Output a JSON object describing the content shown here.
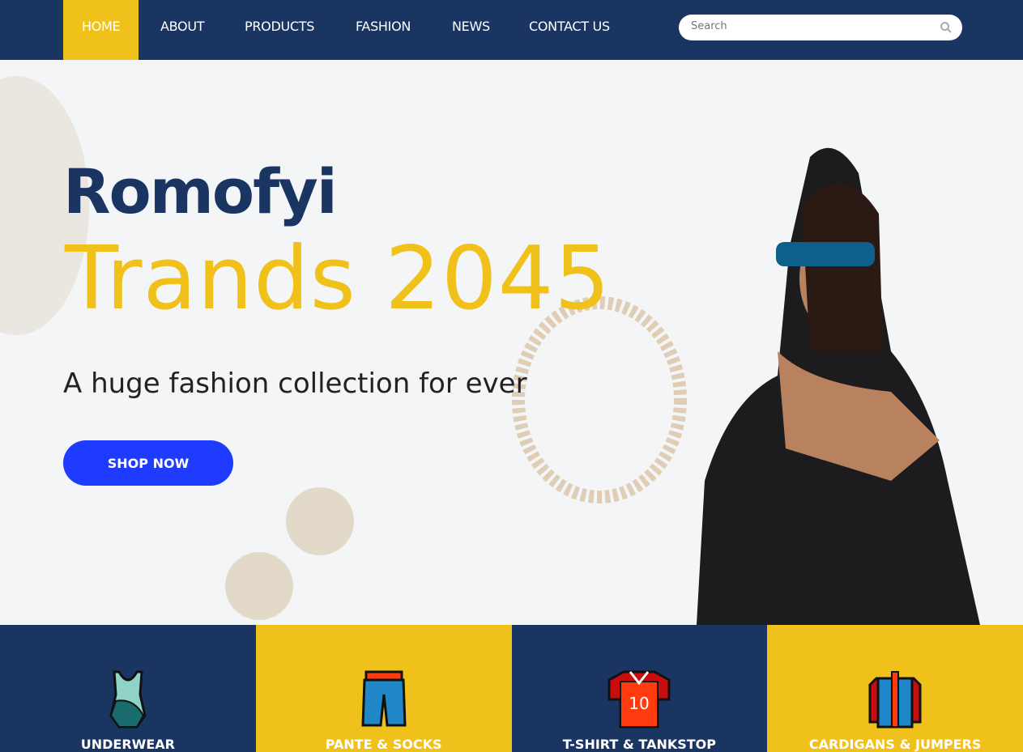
{
  "nav": {
    "items": [
      "HOME",
      "ABOUT",
      "PRODUCTS",
      "FASHION",
      "NEWS",
      "CONTACT US"
    ],
    "active": "HOME",
    "search_placeholder": "Search"
  },
  "hero": {
    "brand": "Romofyi",
    "headline": "Trands 2045",
    "tagline": "A huge fashion collection for ever",
    "cta": "SHOP NOW"
  },
  "categories": [
    {
      "label": "UNDERWEAR",
      "icon": "swimsuit-icon"
    },
    {
      "label": "PANTE & SOCKS",
      "icon": "pants-icon"
    },
    {
      "label": "T-SHIRT & TANKSTOP",
      "icon": "jersey-icon",
      "jersey_number": "10"
    },
    {
      "label": "CARDIGANS & JUMPERS",
      "icon": "jacket-icon"
    }
  ],
  "colors": {
    "navy": "#1b3563",
    "yellow": "#f1c11b",
    "cta": "#1f3bff"
  }
}
